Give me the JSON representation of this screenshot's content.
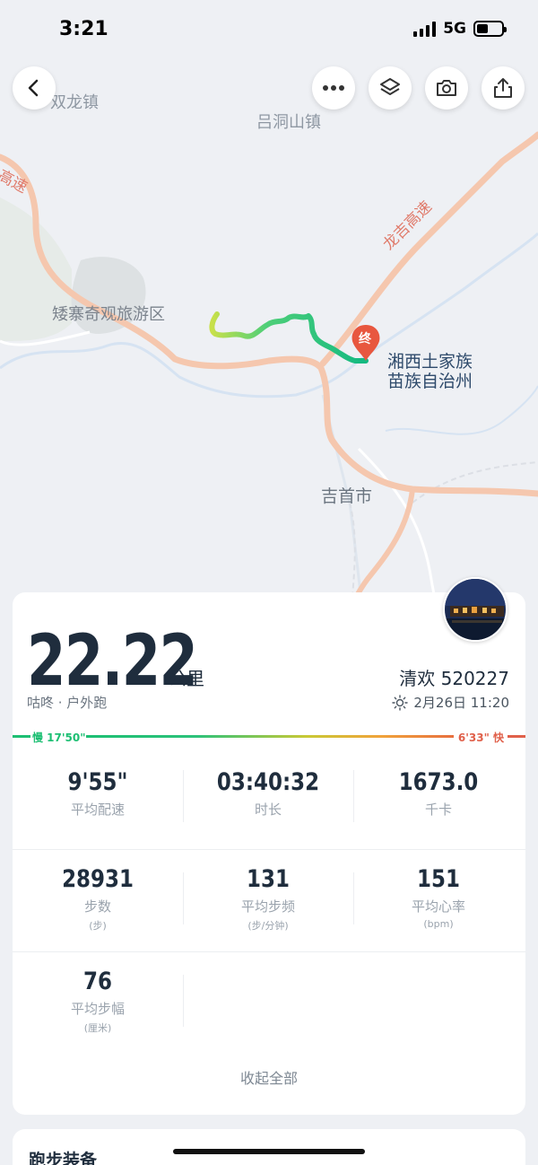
{
  "status_bar": {
    "time": "3:21",
    "network": "5G",
    "battery_fraction": 0.45
  },
  "map": {
    "labels": {
      "shuanglong": "双龙镇",
      "lvdongshan": "吕洞山镇",
      "highway_left": "高速",
      "longji_highway": "龙吉高速",
      "aizhai": "矮寨奇观旅游区",
      "end_marker": "终",
      "region_line1": "湘西土家族",
      "region_line2": "苗族自治州",
      "jishou": "吉首市"
    },
    "route_colors": {
      "start": "#c8e04a",
      "end": "#12b981"
    },
    "end_marker_color": "#e8573f"
  },
  "toolbar": {
    "back_icon": "chevron-left-icon",
    "more_icon": "more-dots-icon",
    "layers_icon": "layers-icon",
    "camera_icon": "camera-icon",
    "share_icon": "share-icon"
  },
  "summary": {
    "distance": "22.22",
    "distance_unit": "公里",
    "source": "咕咚 · 户外跑",
    "username": "清欢 520227",
    "date": "2月26日 11:20",
    "weather_icon": "sun-icon"
  },
  "pace_bar": {
    "slow_label": "慢 17'50\"",
    "fast_label": "6'33\" 快",
    "colors": {
      "slow": "#1dbf73",
      "fast": "#e0604a"
    }
  },
  "stats": [
    {
      "value": "9'55\"",
      "label": "平均配速",
      "sub": ""
    },
    {
      "value": "03:40:32",
      "label": "时长",
      "sub": ""
    },
    {
      "value": "1673.0",
      "label": "千卡",
      "sub": ""
    },
    {
      "value": "28931",
      "label": "步数",
      "sub": "(步)"
    },
    {
      "value": "131",
      "label": "平均步频",
      "sub": "(步/分钟)"
    },
    {
      "value": "151",
      "label": "平均心率",
      "sub": "(bpm)"
    },
    {
      "value": "76",
      "label": "平均步幅",
      "sub": "(厘米)"
    }
  ],
  "collapse_label": "收起全部",
  "gear_section": {
    "title": "跑步装备"
  }
}
